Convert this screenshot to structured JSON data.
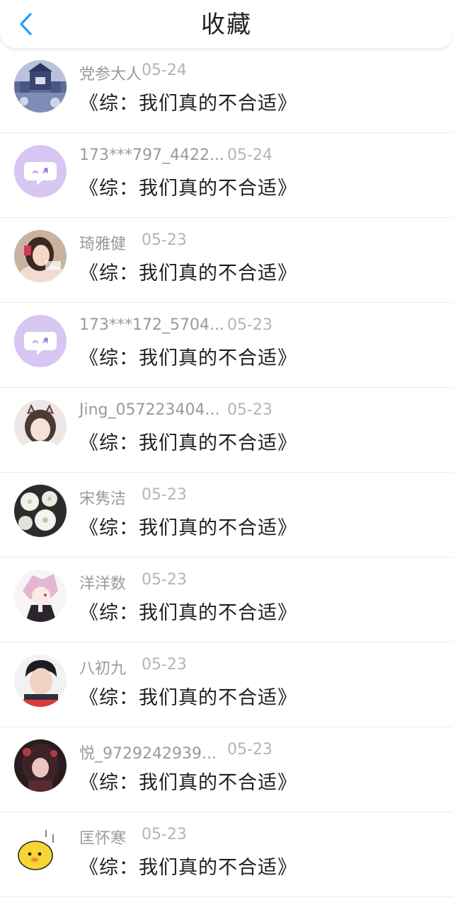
{
  "header": {
    "title": "收藏",
    "accent_color": "#2f9bf0"
  },
  "items": [
    {
      "user": "党参大人",
      "date": "05-24",
      "title": "《综：我们真的不合适》",
      "avatar": "castle-scene-avatar"
    },
    {
      "user": "173***797_4422...",
      "date": "05-24",
      "title": "《综：我们真的不合适》",
      "avatar": "default-chat-bubble-avatar"
    },
    {
      "user": "琦雅健",
      "date": "05-23",
      "title": "《综：我们真的不合适》",
      "avatar": "girl-portrait-avatar"
    },
    {
      "user": "173***172_5704...",
      "date": "05-23",
      "title": "《综：我们真的不合适》",
      "avatar": "default-chat-bubble-avatar"
    },
    {
      "user": "Jing_057223404...",
      "date": "05-23",
      "title": "《综：我们真的不合适》",
      "avatar": "girl-with-cat-ears-avatar"
    },
    {
      "user": "宋隽洁",
      "date": "05-23",
      "title": "《综：我们真的不合适》",
      "avatar": "white-flowers-avatar"
    },
    {
      "user": "洋洋数",
      "date": "05-23",
      "title": "《综：我们真的不合适》",
      "avatar": "anime-pink-hair-avatar"
    },
    {
      "user": "八初九",
      "date": "05-23",
      "title": "《综：我们真的不合适》",
      "avatar": "boy-portrait-avatar"
    },
    {
      "user": "悦_9729242939...",
      "date": "05-23",
      "title": "《综：我们真的不合适》",
      "avatar": "dark-anime-girl-avatar"
    },
    {
      "user": "匡怀寒",
      "date": "05-23",
      "title": "《综：我们真的不合适》",
      "avatar": "yellow-cartoon-avatar"
    }
  ]
}
